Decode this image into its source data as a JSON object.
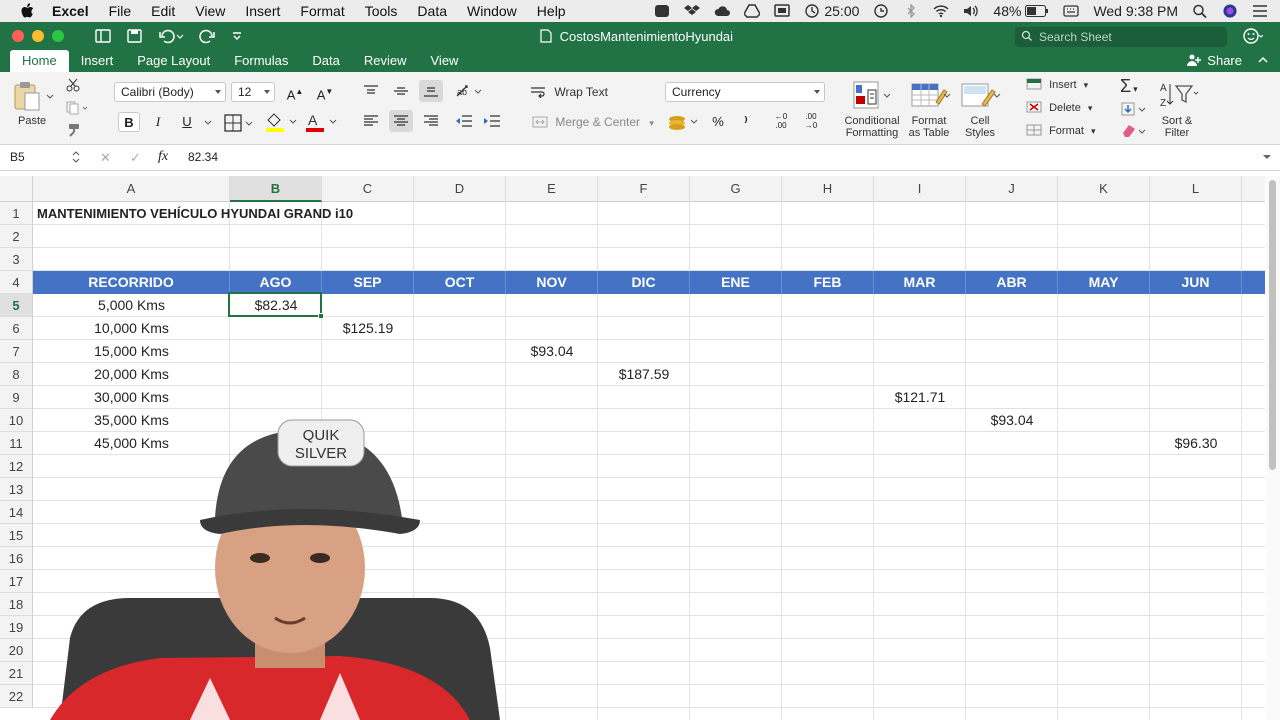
{
  "menubar": {
    "app": "Excel",
    "items": [
      "File",
      "Edit",
      "View",
      "Insert",
      "Format",
      "Tools",
      "Data",
      "Window",
      "Help"
    ],
    "timer": "25:00",
    "battery": "48%",
    "clock": "Wed 9:38 PM"
  },
  "window": {
    "title": "CostosMantenimientoHyundai",
    "search_placeholder": "Search Sheet",
    "share": "Share",
    "tabs": [
      "Home",
      "Insert",
      "Page Layout",
      "Formulas",
      "Data",
      "Review",
      "View"
    ]
  },
  "ribbon": {
    "paste": "Paste",
    "font_name": "Calibri (Body)",
    "font_size": "12",
    "bold": "B",
    "italic": "I",
    "underline": "U",
    "wrap_text": "Wrap Text",
    "merge_center": "Merge & Center",
    "number_format": "Currency",
    "percent": "%",
    "comma": "⁾",
    "conditional_formatting": [
      "Conditional",
      "Formatting"
    ],
    "format_as_table": [
      "Format",
      "as Table"
    ],
    "cell_styles": [
      "Cell",
      "Styles"
    ],
    "insert": "Insert",
    "delete": "Delete",
    "format": "Format",
    "sort_filter": [
      "Sort &",
      "Filter"
    ]
  },
  "formula_bar": {
    "name_box": "B5",
    "fx": "fx",
    "value": "82.34"
  },
  "sheet": {
    "columns": [
      "A",
      "B",
      "C",
      "D",
      "E",
      "F",
      "G",
      "H",
      "I",
      "J",
      "K",
      "L"
    ],
    "rows": [
      "1",
      "2",
      "3",
      "4",
      "5",
      "6",
      "7",
      "8",
      "9",
      "10",
      "11",
      "12",
      "13",
      "14",
      "15",
      "16",
      "17",
      "18",
      "19",
      "20",
      "21",
      "22"
    ],
    "title": "MANTENIMIENTO VEHÍCULO HYUNDAI GRAND i10",
    "header": [
      "RECORRIDO",
      "AGO",
      "SEP",
      "OCT",
      "NOV",
      "DIC",
      "ENE",
      "FEB",
      "MAR",
      "ABR",
      "MAY",
      "JUN"
    ],
    "data_rows": [
      {
        "recorrido": "5,000 Kms",
        "col": 1,
        "value": "$82.34"
      },
      {
        "recorrido": "10,000 Kms",
        "col": 2,
        "value": "$125.19"
      },
      {
        "recorrido": "15,000 Kms",
        "col": 4,
        "value": "$93.04"
      },
      {
        "recorrido": "20,000 Kms",
        "col": 5,
        "value": "$187.59"
      },
      {
        "recorrido": "30,000 Kms",
        "col": 8,
        "value": "$121.71"
      },
      {
        "recorrido": "35,000 Kms",
        "col": 9,
        "value": "$93.04"
      },
      {
        "recorrido": "45,000 Kms",
        "col": 11,
        "value": "$96.30"
      }
    ],
    "selected_cell": "B5"
  },
  "overlay": {
    "cap_text": [
      "QUIK",
      "SILVER"
    ]
  },
  "colors": {
    "excel_green": "#217346",
    "header_blue": "#4472c4"
  }
}
